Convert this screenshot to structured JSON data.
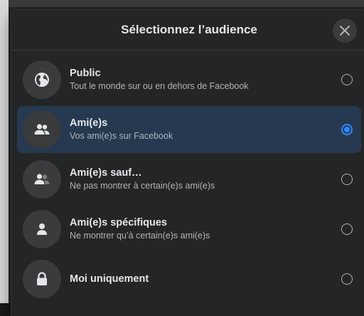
{
  "dialog": {
    "title": "Sélectionnez l’audience"
  },
  "options": [
    {
      "title": "Public",
      "subtitle": "Tout le monde sur ou en dehors de Facebook",
      "icon": "globe-icon",
      "selected": false
    },
    {
      "title": "Ami(e)s",
      "subtitle": "Vos ami(e)s sur Facebook",
      "icon": "friends-icon",
      "selected": true
    },
    {
      "title": "Ami(e)s sauf…",
      "subtitle": "Ne pas montrer à certain(e)s ami(e)s",
      "icon": "friends-except-icon",
      "selected": false
    },
    {
      "title": "Ami(e)s spécifiques",
      "subtitle": "Ne montrer qu’à certain(e)s ami(e)s",
      "icon": "person-icon",
      "selected": false
    },
    {
      "title": "Moi uniquement",
      "subtitle": "",
      "icon": "lock-icon",
      "selected": false
    }
  ],
  "colors": {
    "background": "#242526",
    "selected_row": "#263951",
    "accent": "#2d88ff",
    "text_primary": "#e4e6eb",
    "text_secondary": "#b0b3b8"
  }
}
